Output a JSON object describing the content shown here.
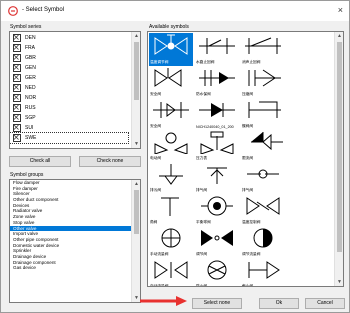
{
  "window": {
    "title": "- Select Symbol",
    "close_glyph": "×"
  },
  "series": {
    "label": "Symbol series",
    "items": [
      "DEN",
      "FRA",
      "GBR",
      "GEN",
      "GER",
      "NED",
      "NOR",
      "RUS",
      "SGP",
      "SUI",
      "SWE"
    ],
    "selected": "SWE"
  },
  "buttons": {
    "check_all": "Check all",
    "check_none": "Check none",
    "select_none": "Select none",
    "ok": "Ok",
    "cancel": "Cancel"
  },
  "groups": {
    "label": "Symbol groups",
    "items": [
      "Flow damper",
      "Fire damper",
      "Silencer",
      "Other duct component",
      "Devices",
      "Radiator valve",
      "Zone valve",
      "Stop valve",
      "Other valve",
      "Import valve",
      "Other pipe component",
      "Domestic water device",
      "Sprinkler",
      "Drainage device",
      "Drainage component",
      "Gas device"
    ],
    "selected": "Other valve"
  },
  "symbols": {
    "label": "Available symbols",
    "captions": [
      "温度调节阀",
      "水路止回阀",
      "消声止回阀",
      "",
      "安全阀",
      "防水保阀",
      "压缩阀",
      "",
      "安全阀",
      "NICH1240040_01_200",
      "蝶阀阀",
      "",
      "电动阀",
      "压力表",
      "限流阀",
      "",
      "排污阀",
      "排气阀",
      "排气阀",
      "",
      "角阀",
      "平衡球阀",
      "温度控制阀",
      "",
      "手动流量阀",
      "调节阀",
      "调节流量阀",
      "",
      "自动流量阀",
      "防火阀",
      "截止阀",
      ""
    ],
    "selected_index": 0
  },
  "colors": {
    "accent": "#0078d7",
    "arrow": "#e8312f"
  }
}
